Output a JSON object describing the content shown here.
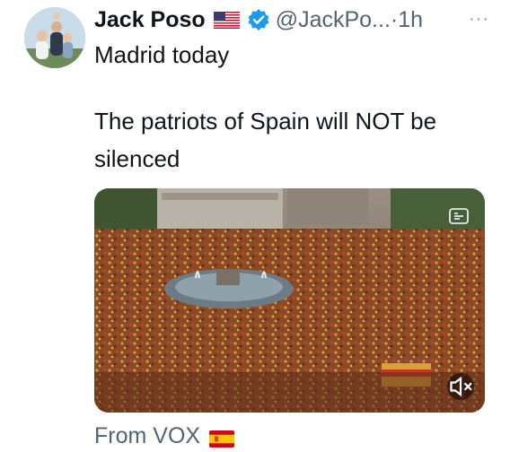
{
  "tweet": {
    "author_name": "Jack Poso",
    "author_flag_icon": "us-flag-icon",
    "verified_icon": "verified-badge-icon",
    "handle": "@JackPo...",
    "separator": "·",
    "time": "1h",
    "more_label": "···",
    "text_line1": "Madrid today",
    "text_line2": "The patriots of Spain will NOT be",
    "text_line3": "silenced",
    "media": {
      "kind": "video",
      "description_icon": "media-settings-icon",
      "mute_icon": "muted-speaker-icon"
    },
    "source_prefix": "From",
    "source_name": "VOX",
    "source_flag_icon": "spain-flag-icon",
    "colors": {
      "verified_blue": "#1d9bf0",
      "secondary_text": "#536471"
    }
  }
}
